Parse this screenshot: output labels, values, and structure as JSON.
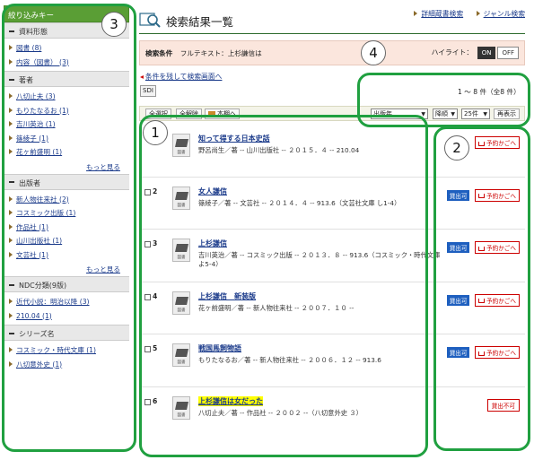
{
  "sidebar": {
    "title": "絞り込みキー",
    "sections": [
      {
        "heading": "資料形態",
        "items": [
          "図書 (8)",
          "内容（図書） (3)"
        ],
        "more": ""
      },
      {
        "heading": "著者",
        "items": [
          "八切止夫 (3)",
          "もりたなるお (1)",
          "吉川英治 (1)",
          "篠綾子 (1)",
          "花ヶ前盛明 (1)"
        ],
        "more": "もっと見る"
      },
      {
        "heading": "出版者",
        "items": [
          "新人物往来社 (2)",
          "コスミック出版 (1)",
          "作品社 (1)",
          "山川出版社 (1)",
          "文芸社 (1)"
        ],
        "more": "もっと見る"
      },
      {
        "heading": "NDC分類(9版)",
        "items": [
          "近代小説：明治以降 (3)",
          "210.04 (1)"
        ],
        "more": ""
      },
      {
        "heading": "シリーズ名",
        "items": [
          "コスミック・時代文庫 (1)",
          "八切意外史 (1)"
        ],
        "more": ""
      }
    ]
  },
  "header": {
    "title": "検索結果一覧",
    "links": [
      "詳細蔵書検索",
      "ジャンル検索"
    ]
  },
  "condition": {
    "label": "検索条件",
    "text": "フルテキスト：上杉謙信は",
    "highlight_label": "ハイライト：",
    "on": "ON",
    "off": "OFF"
  },
  "back_link": "条件を残して検索画面へ",
  "sdi": "SDI",
  "range": "1 ～ 8 件（全8 件）",
  "toolbar": {
    "select_all": "全選択",
    "clear_all": "全解除",
    "bookshelf": "本棚へ",
    "sort": "出版年",
    "order": "降順",
    "per_page": "25件",
    "redisplay": "再表示"
  },
  "results": [
    {
      "num": "1",
      "title": "知って得する日本史話",
      "meta": "野呂尚生／著 -- 山川出版社 -- ２０１５．４ -- 210.04",
      "available": "",
      "reserve": "予約かごへ",
      "unavailable": "",
      "highlight": false
    },
    {
      "num": "2",
      "title": "女人謙信",
      "meta": "篠綾子／著 -- 文芸社 -- ２０１４．４ -- 913.6（文芸社文庫 し1-4）",
      "available": "貸出可",
      "reserve": "予約かごへ",
      "unavailable": "",
      "highlight": false
    },
    {
      "num": "3",
      "title": "上杉謙信",
      "meta": "吉川英治／著 -- コスミック出版 -- ２０１３．８ -- 913.6（コスミック・時代文庫 よ5-4）",
      "available": "貸出可",
      "reserve": "予約かごへ",
      "unavailable": "",
      "highlight": false
    },
    {
      "num": "4",
      "title": "上杉謙信　新装版",
      "meta": "花ヶ前盛明／著 -- 新人物往来社 -- ２００７．１０ --",
      "available": "貸出可",
      "reserve": "予約かごへ",
      "unavailable": "",
      "highlight": false
    },
    {
      "num": "5",
      "title": "戦国馬飼物語",
      "meta": "もりたなるお／著 -- 新人物往来社 -- ２００６．１２ -- 913.6",
      "available": "貸出可",
      "reserve": "予約かごへ",
      "unavailable": "",
      "highlight": false
    },
    {
      "num": "6",
      "title": "上杉謙信は女だった",
      "meta": "八切止夫／著 -- 作品社 -- ２００２ --（八切意外史 ３）",
      "available": "",
      "reserve": "",
      "unavailable": "貸出不可",
      "highlight": true
    }
  ],
  "book_icon_label": "図書",
  "annotations": [
    "1",
    "2",
    "3",
    "4"
  ],
  "colors": {
    "accent_green": "#20a040",
    "sidebar_green": "#5a9e35",
    "available_blue": "#1e5fbf",
    "reserve_red": "#cc0000"
  }
}
